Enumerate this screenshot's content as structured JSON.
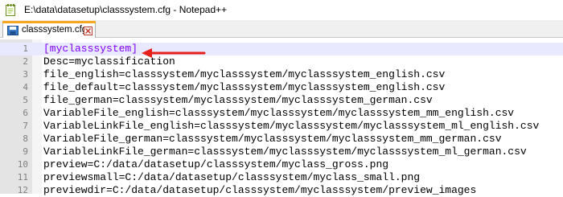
{
  "window": {
    "title": "E:\\data\\datasetup\\classsystem.cfg - Notepad++",
    "app_icon": "notepad-plus-plus-icon"
  },
  "tab": {
    "label": "classsystem.cfg",
    "icon": "save-file-icon",
    "close_icon": "close-x-icon",
    "accent_color": "#f5a623"
  },
  "editor": {
    "current_line_color": "#e8e8ff",
    "annotation": {
      "icon": "red-arrow-left-icon",
      "color": "#e8201a"
    },
    "lines": [
      {
        "number": "1",
        "text": "[myclasssystem]"
      },
      {
        "number": "2",
        "text": "Desc=myclassification"
      },
      {
        "number": "3",
        "text": "file_english=classsystem/myclasssystem/myclasssystem_english.csv"
      },
      {
        "number": "4",
        "text": "file_default=classsystem/myclasssystem/myclasssystem_english.csv"
      },
      {
        "number": "5",
        "text": "file_german=classsystem/myclasssystem/myclasssystem_german.csv"
      },
      {
        "number": "6",
        "text": "VariableFile_english=classsystem/myclasssystem/myclasssystem_mm_english.csv"
      },
      {
        "number": "7",
        "text": "VariableLinkFile_english=classsystem/myclasssystem/myclasssystem_ml_english.csv"
      },
      {
        "number": "8",
        "text": "VariableFile_german=classsystem/myclasssystem/myclasssystem_mm_german.csv"
      },
      {
        "number": "9",
        "text": "VariableLinkFile_german=classsystem/myclasssystem/myclasssystem_ml_german.csv"
      },
      {
        "number": "10",
        "text": "preview=C:/data/datasetup/classsystem/myclass_gross.png"
      },
      {
        "number": "11",
        "text": "previewsmall=C:/data/datasetup/classsystem/myclass_small.png"
      },
      {
        "number": "12",
        "text": "previewdir=C:/data/datasetup/classsystem/myclasssystem/preview_images"
      }
    ]
  }
}
